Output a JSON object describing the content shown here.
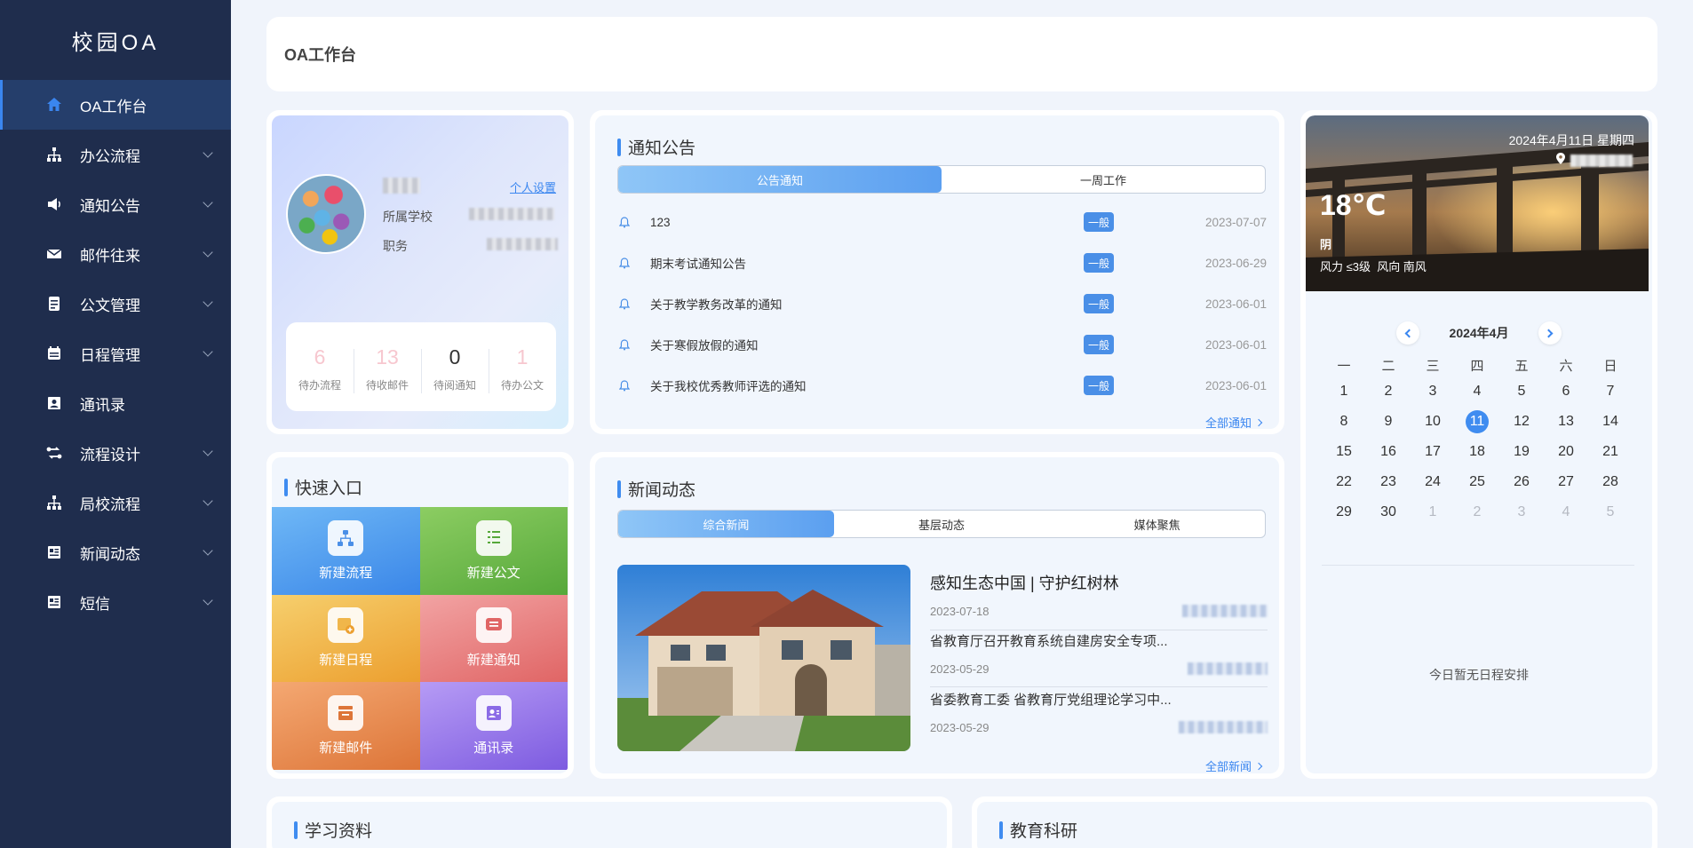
{
  "app": {
    "brand": "校园OA"
  },
  "sidebar": {
    "items": [
      {
        "label": "OA工作台",
        "icon": "home-icon"
      },
      {
        "label": "办公流程",
        "icon": "org-chart-icon"
      },
      {
        "label": "通知公告",
        "icon": "speaker-icon"
      },
      {
        "label": "邮件往来",
        "icon": "mail-icon"
      },
      {
        "label": "公文管理",
        "icon": "document-icon"
      },
      {
        "label": "日程管理",
        "icon": "calendar-icon"
      },
      {
        "label": "通讯录",
        "icon": "contacts-icon"
      },
      {
        "label": "流程设计",
        "icon": "flow-icon"
      },
      {
        "label": "局校流程",
        "icon": "org-chart-icon"
      },
      {
        "label": "新闻动态",
        "icon": "news-icon"
      },
      {
        "label": "短信",
        "icon": "sms-icon"
      }
    ]
  },
  "header": {
    "title": "OA工作台"
  },
  "profile": {
    "settings_link": "个人设置",
    "school_label": "所属学校",
    "position_label": "职务",
    "stats": [
      {
        "value": "6",
        "label": "待办流程",
        "color": "#f7c7cf"
      },
      {
        "value": "13",
        "label": "待收邮件",
        "color": "#f7c7cf"
      },
      {
        "value": "0",
        "label": "待阅通知",
        "color": "#333333"
      },
      {
        "value": "1",
        "label": "待办公文",
        "color": "#f7c7cf"
      }
    ]
  },
  "notices": {
    "title": "通知公告",
    "tabs": [
      "公告通知",
      "一周工作"
    ],
    "items": [
      {
        "title": "123",
        "tag": "一般",
        "date": "2023-07-07"
      },
      {
        "title": "期末考试通知公告",
        "tag": "一般",
        "date": "2023-06-29"
      },
      {
        "title": "关于教学教务改革的通知",
        "tag": "一般",
        "date": "2023-06-01"
      },
      {
        "title": "关于寒假放假的通知",
        "tag": "一般",
        "date": "2023-06-01"
      },
      {
        "title": "关于我校优秀教师评选的通知",
        "tag": "一般",
        "date": "2023-06-01"
      }
    ],
    "more": "全部通知"
  },
  "weather": {
    "date": "2024年4月11日 星期四",
    "temp": "18℃",
    "condition": "阴",
    "wind": "风力 ≤3级  风向 南风"
  },
  "calendar": {
    "month_label": "2024年4月",
    "weekdays": [
      "一",
      "二",
      "三",
      "四",
      "五",
      "六",
      "日"
    ],
    "today": 11,
    "days": [
      "1",
      "2",
      "3",
      "4",
      "5",
      "6",
      "7",
      "8",
      "9",
      "10",
      "11",
      "12",
      "13",
      "14",
      "15",
      "16",
      "17",
      "18",
      "19",
      "20",
      "21",
      "22",
      "23",
      "24",
      "25",
      "26",
      "27",
      "28",
      "29",
      "30",
      "1",
      "2",
      "3",
      "4",
      "5"
    ],
    "empty_text": "今日暂无日程安排"
  },
  "quick": {
    "title": "快速入口",
    "items": [
      {
        "label": "新建流程",
        "icon": "workflow-icon",
        "color_from": "#6fb8f6",
        "color_to": "#3a86e8"
      },
      {
        "label": "新建公文",
        "icon": "document-icon",
        "color_from": "#8ccd62",
        "color_to": "#56a83a"
      },
      {
        "label": "新建日程",
        "icon": "calendar-add-icon",
        "color_from": "#f6cf6d",
        "color_to": "#ec9f2f"
      },
      {
        "label": "新建通知",
        "icon": "message-icon",
        "color_from": "#f2a3a3",
        "color_to": "#e06565"
      },
      {
        "label": "新建邮件",
        "icon": "inbox-icon",
        "color_from": "#f4a872",
        "color_to": "#dd7538"
      },
      {
        "label": "通讯录",
        "icon": "contacts-icon",
        "color_from": "#b69bf5",
        "color_to": "#7d5be0"
      }
    ]
  },
  "news": {
    "title": "新闻动态",
    "tabs": [
      "综合新闻",
      "基层动态",
      "媒体聚焦"
    ],
    "items": [
      {
        "title": "感知生态中国 | 守护红树林",
        "date": "2023-07-18"
      },
      {
        "title": "省教育厅召开教育系统自建房安全专项...",
        "date": "2023-05-29"
      },
      {
        "title": "省委教育工委 省教育厅党组理论学习中...",
        "date": "2023-05-29"
      }
    ],
    "more": "全部新闻"
  },
  "bottom": {
    "left_title": "学习资料",
    "right_title": "教育科研"
  }
}
